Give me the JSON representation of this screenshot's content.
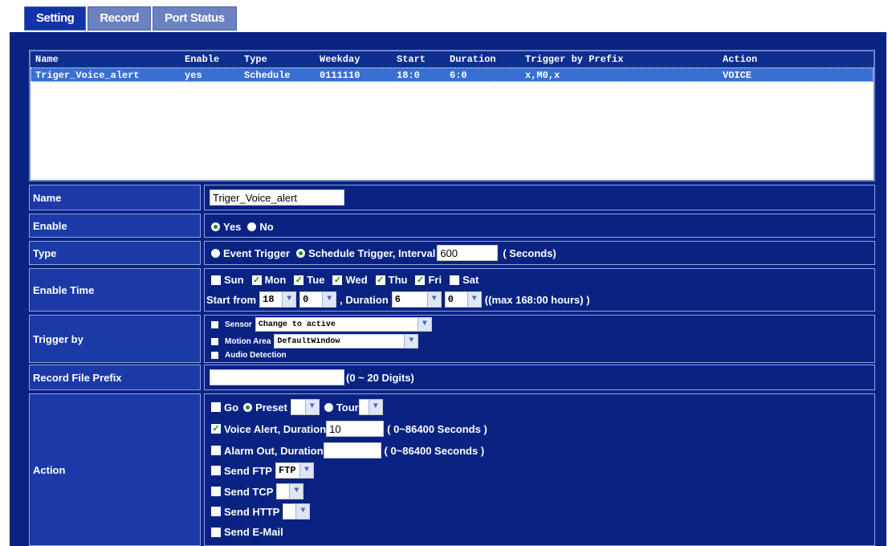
{
  "tabs": [
    "Setting",
    "Record",
    "Port Status"
  ],
  "list": {
    "headers": [
      "Name",
      "Enable",
      "Type",
      "Weekday",
      "Start",
      "Duration",
      "Trigger by Prefix",
      "Action"
    ],
    "rows": [
      [
        "Triger_Voice_alert",
        "yes",
        "Schedule",
        "0111110",
        "18:0",
        "6:0",
        "x,M0,x",
        "VOICE"
      ]
    ]
  },
  "form": {
    "name": {
      "label": "Name",
      "value": "Triger_Voice_alert"
    },
    "enable": {
      "label": "Enable",
      "yes": "Yes",
      "no": "No",
      "selected": "Yes"
    },
    "type": {
      "label": "Type",
      "event": "Event Trigger",
      "schedule": "Schedule Trigger, Interval",
      "interval": "600",
      "unit": "( Seconds)",
      "selected": "Schedule Trigger"
    },
    "enable_time": {
      "label": "Enable Time",
      "days": [
        {
          "name": "Sun",
          "checked": false
        },
        {
          "name": "Mon",
          "checked": true
        },
        {
          "name": "Tue",
          "checked": true
        },
        {
          "name": "Wed",
          "checked": true
        },
        {
          "name": "Thu",
          "checked": true
        },
        {
          "name": "Fri",
          "checked": true
        },
        {
          "name": "Sat",
          "checked": false
        }
      ],
      "start_label": "Start from",
      "start_hour": "18",
      "start_min": "0",
      "duration_label": ", Duration",
      "duration_hour": "6",
      "duration_min": "0",
      "max_note": "((max 168:00 hours) )"
    },
    "trigger_by": {
      "label": "Trigger by",
      "sensor": "Sensor",
      "sensor_value": "Change to active",
      "motion": "Motion Area",
      "motion_value": "DefaultWindow",
      "audio": "Audio Detection"
    },
    "prefix": {
      "label": "Record File Prefix",
      "value": "",
      "note": "(0 ~ 20 Digits)"
    },
    "action": {
      "label": "Action",
      "go": "Go",
      "preset": "Preset",
      "tour": "Tour",
      "voice": "Voice Alert, Duration",
      "voice_value": "10",
      "voice_note": "( 0~86400 Seconds )",
      "alarm": "Alarm Out, Duration",
      "alarm_value": "",
      "alarm_note": "( 0~86400 Seconds )",
      "ftp": "Send FTP",
      "ftp_value": "FTP",
      "tcp": "Send TCP",
      "http": "Send HTTP",
      "email": "Send E-Mail"
    }
  },
  "colors": {
    "panel": "#0a2383",
    "label_bg": "#1b3aa8",
    "selected_row": "#3a6fd2",
    "check": "#1b8f1b"
  }
}
